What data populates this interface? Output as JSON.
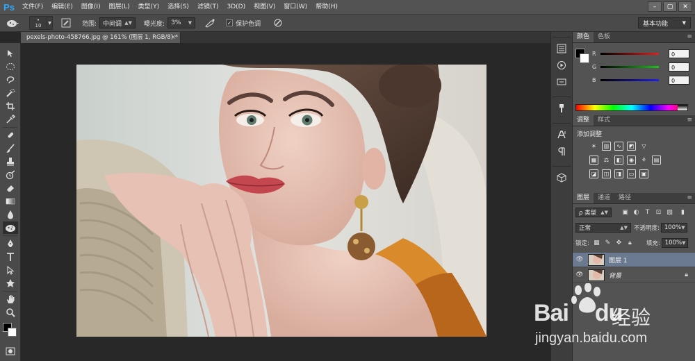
{
  "app": {
    "logo": "Ps"
  },
  "menu": [
    "文件(F)",
    "编辑(E)",
    "图像(I)",
    "图层(L)",
    "类型(Y)",
    "选择(S)",
    "滤镜(T)",
    "3D(D)",
    "视图(V)",
    "窗口(W)",
    "帮助(H)"
  ],
  "window_controls": [
    "–",
    "▢",
    "✕"
  ],
  "options": {
    "brush_size": "10",
    "range_label": "范围:",
    "range_value": "中间调",
    "exposure_label": "曝光度:",
    "exposure_value": "3%",
    "protect_tones_label": "保护色调",
    "protect_tones_checked": "✓",
    "workspace": "基本功能"
  },
  "document": {
    "tab_title": "pexels-photo-458766.jpg @ 161% (图层 1, RGB/8) *",
    "close": "×"
  },
  "color_panel": {
    "tabs": [
      "颜色",
      "色板"
    ],
    "r_label": "R",
    "r_value": "0",
    "g_label": "G",
    "g_value": "0",
    "b_label": "B",
    "b_value": "0",
    "colors": {
      "red": "#e02020",
      "green": "#20c020",
      "blue": "#2020e0"
    }
  },
  "adjustments_panel": {
    "tabs": [
      "调整",
      "样式"
    ],
    "title": "添加调整"
  },
  "layers_panel": {
    "tabs": [
      "图层",
      "通道",
      "路径"
    ],
    "filter_kind": "ρ 类型",
    "blend_mode": "正常",
    "opacity_label": "不透明度:",
    "opacity_value": "100%",
    "lock_label": "锁定:",
    "fill_label": "填充:",
    "fill_value": "100%",
    "layers": [
      {
        "name": "图层 1",
        "selected": true
      },
      {
        "name": "背景",
        "locked": true
      }
    ]
  },
  "watermark": {
    "brand": "Bai",
    "brand_tail": "du",
    "cn": "经验",
    "url": "jingyan.baidu.com"
  }
}
